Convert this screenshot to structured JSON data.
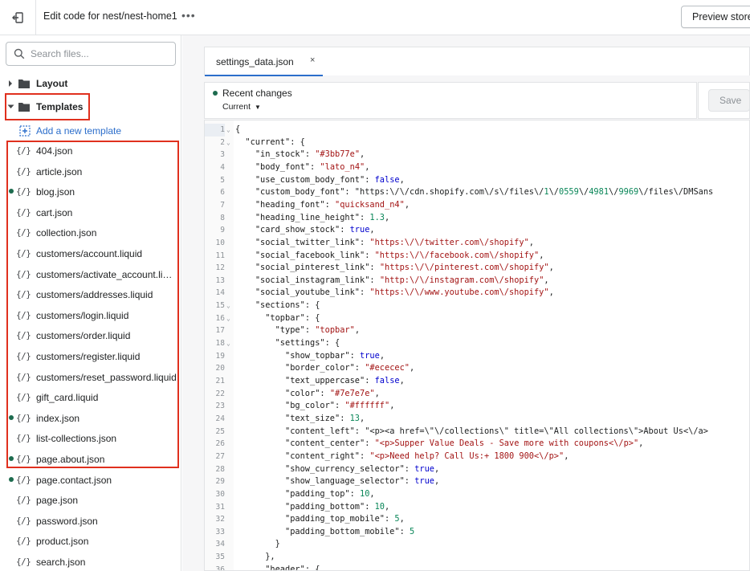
{
  "topbar": {
    "title": "Edit code for nest/nest-home1",
    "more": "•••",
    "preview_label": "Preview store"
  },
  "search": {
    "placeholder": "Search files..."
  },
  "tree": {
    "layout_label": "Layout",
    "templates_label": "Templates",
    "add_template_label": "Add a new template",
    "file_icon": "{/}",
    "files": [
      {
        "name": "404.json",
        "modified": false
      },
      {
        "name": "article.json",
        "modified": false
      },
      {
        "name": "blog.json",
        "modified": true
      },
      {
        "name": "cart.json",
        "modified": false
      },
      {
        "name": "collection.json",
        "modified": false
      },
      {
        "name": "customers/account.liquid",
        "modified": false
      },
      {
        "name": "customers/activate_account.liquid",
        "modified": false
      },
      {
        "name": "customers/addresses.liquid",
        "modified": false
      },
      {
        "name": "customers/login.liquid",
        "modified": false
      },
      {
        "name": "customers/order.liquid",
        "modified": false
      },
      {
        "name": "customers/register.liquid",
        "modified": false
      },
      {
        "name": "customers/reset_password.liquid",
        "modified": false
      },
      {
        "name": "gift_card.liquid",
        "modified": false
      },
      {
        "name": "index.json",
        "modified": true
      },
      {
        "name": "list-collections.json",
        "modified": false
      },
      {
        "name": "page.about.json",
        "modified": true
      },
      {
        "name": "page.contact.json",
        "modified": true
      },
      {
        "name": "page.json",
        "modified": false
      },
      {
        "name": "password.json",
        "modified": false
      },
      {
        "name": "product.json",
        "modified": false
      },
      {
        "name": "search.json",
        "modified": false
      }
    ]
  },
  "editor": {
    "tab_label": "settings_data.json",
    "tab_close": "×",
    "recent_title": "Recent changes",
    "recent_select": "Current",
    "save_label": "Save",
    "lines": [
      {
        "n": "1",
        "fold": true,
        "text": "{"
      },
      {
        "n": "2",
        "fold": true,
        "text": "  \"current\": {"
      },
      {
        "n": "3",
        "fold": false,
        "text": "    \"in_stock\": \"#3bb77e\","
      },
      {
        "n": "4",
        "fold": false,
        "text": "    \"body_font\": \"lato_n4\","
      },
      {
        "n": "5",
        "fold": false,
        "text": "    \"use_custom_body_font\": false,"
      },
      {
        "n": "6",
        "fold": false,
        "text": "    \"custom_body_font\": \"https:\\/\\/cdn.shopify.com\\/s\\/files\\/1\\/0559\\/4981\\/9969\\/files\\/DMSans"
      },
      {
        "n": "7",
        "fold": false,
        "text": "    \"heading_font\": \"quicksand_n4\","
      },
      {
        "n": "8",
        "fold": false,
        "text": "    \"heading_line_height\": 1.3,"
      },
      {
        "n": "9",
        "fold": false,
        "text": "    \"card_show_stock\": true,"
      },
      {
        "n": "10",
        "fold": false,
        "text": "    \"social_twitter_link\": \"https:\\/\\/twitter.com\\/shopify\","
      },
      {
        "n": "11",
        "fold": false,
        "text": "    \"social_facebook_link\": \"https:\\/\\/facebook.com\\/shopify\","
      },
      {
        "n": "12",
        "fold": false,
        "text": "    \"social_pinterest_link\": \"https:\\/\\/pinterest.com\\/shopify\","
      },
      {
        "n": "13",
        "fold": false,
        "text": "    \"social_instagram_link\": \"http:\\/\\/instagram.com\\/shopify\","
      },
      {
        "n": "14",
        "fold": false,
        "text": "    \"social_youtube_link\": \"https:\\/\\/www.youtube.com\\/shopify\","
      },
      {
        "n": "15",
        "fold": true,
        "text": "    \"sections\": {"
      },
      {
        "n": "16",
        "fold": true,
        "text": "      \"topbar\": {"
      },
      {
        "n": "17",
        "fold": false,
        "text": "        \"type\": \"topbar\","
      },
      {
        "n": "18",
        "fold": true,
        "text": "        \"settings\": {"
      },
      {
        "n": "19",
        "fold": false,
        "text": "          \"show_topbar\": true,"
      },
      {
        "n": "20",
        "fold": false,
        "text": "          \"border_color\": \"#ececec\","
      },
      {
        "n": "21",
        "fold": false,
        "text": "          \"text_uppercase\": false,"
      },
      {
        "n": "22",
        "fold": false,
        "text": "          \"color\": \"#7e7e7e\","
      },
      {
        "n": "23",
        "fold": false,
        "text": "          \"bg_color\": \"#ffffff\","
      },
      {
        "n": "24",
        "fold": false,
        "text": "          \"text_size\": 13,"
      },
      {
        "n": "25",
        "fold": false,
        "text": "          \"content_left\": \"<p><a href=\\\"\\/collections\\\" title=\\\"All collections\\\">About Us<\\/a>"
      },
      {
        "n": "26",
        "fold": false,
        "text": "          \"content_center\": \"<p>Supper Value Deals - Save more with coupons<\\/p>\","
      },
      {
        "n": "27",
        "fold": false,
        "text": "          \"content_right\": \"<p>Need help? Call Us:+ 1800 900<\\/p>\","
      },
      {
        "n": "28",
        "fold": false,
        "text": "          \"show_currency_selector\": true,"
      },
      {
        "n": "29",
        "fold": false,
        "text": "          \"show_language_selector\": true,"
      },
      {
        "n": "30",
        "fold": false,
        "text": "          \"padding_top\": 10,"
      },
      {
        "n": "31",
        "fold": false,
        "text": "          \"padding_bottom\": 10,"
      },
      {
        "n": "32",
        "fold": false,
        "text": "          \"padding_top_mobile\": 5,"
      },
      {
        "n": "33",
        "fold": false,
        "text": "          \"padding_bottom_mobile\": 5"
      },
      {
        "n": "34",
        "fold": false,
        "text": "        }"
      },
      {
        "n": "35",
        "fold": false,
        "text": "      },"
      },
      {
        "n": "36",
        "fold": true,
        "text": "      \"header\": {"
      }
    ]
  },
  "colors": {
    "accent": "#2c6ecb",
    "highlight": "#e0301e",
    "modified_dot": "#1d6b4e"
  }
}
